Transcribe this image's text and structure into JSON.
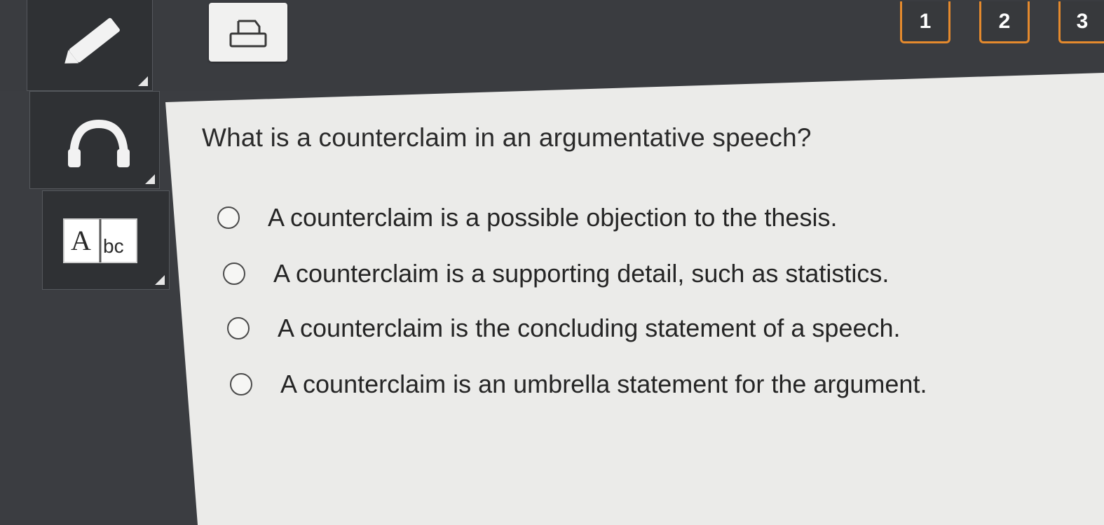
{
  "toolbar": {
    "tools": [
      {
        "name": "pencil",
        "icon": "pencil-icon"
      },
      {
        "name": "audio",
        "icon": "headphones-icon"
      },
      {
        "name": "dictionary",
        "icon": "abc-book-icon",
        "icon_text_a": "A",
        "icon_text_bc": "bc"
      }
    ],
    "print_icon": "print-icon"
  },
  "pagination": {
    "pages": [
      "1",
      "2",
      "3"
    ],
    "accent_color": "#e58a2d"
  },
  "question": {
    "text": "What is a counterclaim in an argumentative speech?",
    "options": [
      "A counterclaim is a possible objection to the thesis.",
      "A counterclaim is a supporting detail, such as statistics.",
      "A counterclaim is the concluding statement of a speech.",
      "A counterclaim is an umbrella statement for the argument."
    ]
  }
}
